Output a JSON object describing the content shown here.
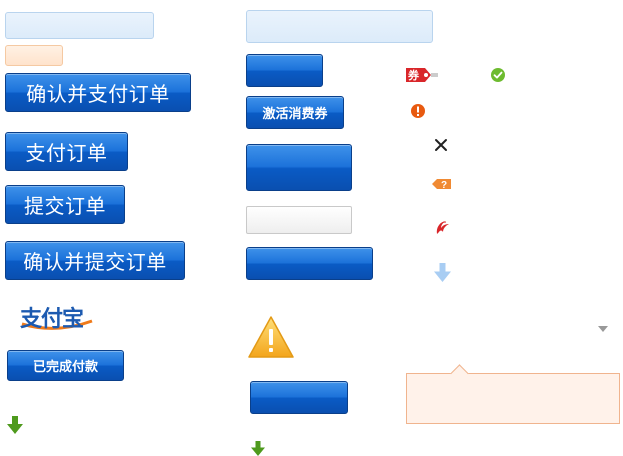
{
  "buttons": {
    "confirm_pay_order": "确认并支付订单",
    "pay_order": "支付订单",
    "submit_order": "提交订单",
    "confirm_submit_order": "确认并提交订单",
    "payment_completed": "已完成付款",
    "activate_voucher": "激活消费券"
  },
  "logo": {
    "alipay_text": "支付宝"
  },
  "badges": {
    "voucher_label": "券"
  },
  "icons": [
    "voucher-tag-icon",
    "success-check-icon",
    "error-exclamation-icon",
    "close-x-icon",
    "help-question-tag-icon",
    "airline-phoenix-icon",
    "down-arrow-light-blue-icon",
    "dropdown-triangle-icon",
    "warning-triangle-icon",
    "down-arrow-green-icon"
  ],
  "colors": {
    "button_blue": "#1c72da",
    "light_blue_box": "#dcebfa",
    "peach_box": "#ffe3cc",
    "success_green": "#6dbb2f",
    "error_orange": "#e85a10",
    "warning_yellow": "#f7b733",
    "popover_bg": "#fff2ea",
    "airline_red": "#d9262a",
    "arrow_green": "#4e9a1d"
  }
}
